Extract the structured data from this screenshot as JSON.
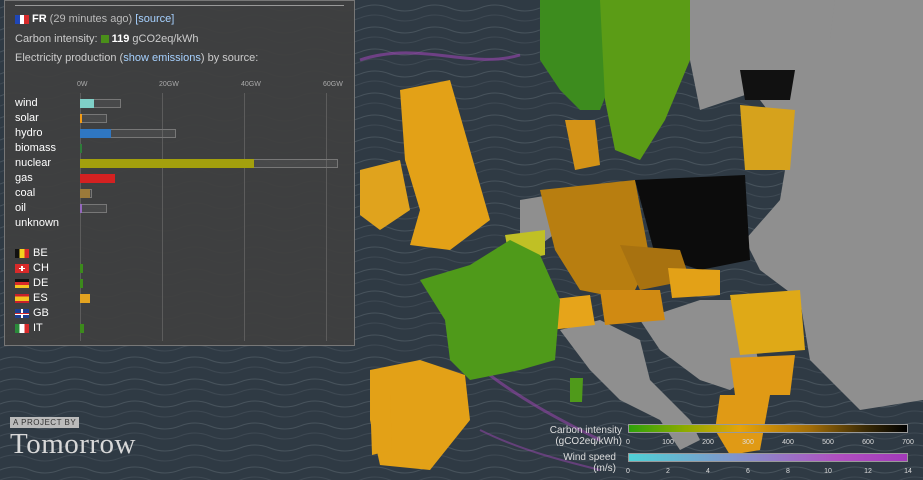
{
  "panel": {
    "country_code": "FR",
    "updated": "(29 minutes ago)",
    "source_link": "[source]",
    "carbon_label": "Carbon intensity:",
    "carbon_value": "119",
    "carbon_unit": "gCO2eq/kWh",
    "production_prefix": "Electricity production (",
    "production_link": "show emissions",
    "production_suffix": ") by source:",
    "axis_ticks": [
      "0W",
      "20GW",
      "40GW",
      "60GW"
    ],
    "sources": [
      {
        "name": "wind",
        "color": "#7fd0c8",
        "value_gw": 3.5,
        "capacity_gw": 10
      },
      {
        "name": "solar",
        "color": "#f39b14",
        "value_gw": 0.5,
        "capacity_gw": 6.5
      },
      {
        "name": "hydro",
        "color": "#2f77c2",
        "value_gw": 7.5,
        "capacity_gw": 23.5
      },
      {
        "name": "biomass",
        "color": "#2e7d3a",
        "value_gw": 0.4,
        "capacity_gw": 0
      },
      {
        "name": "nuclear",
        "color": "#a3a00d",
        "value_gw": 42.5,
        "capacity_gw": 63
      },
      {
        "name": "gas",
        "color": "#d42121",
        "value_gw": 8.5,
        "capacity_gw": 0
      },
      {
        "name": "coal",
        "color": "#9b7a3a",
        "value_gw": 2.5,
        "capacity_gw": 3
      },
      {
        "name": "oil",
        "color": "#9467bd",
        "value_gw": 0.4,
        "capacity_gw": 6.5
      },
      {
        "name": "unknown",
        "color": "#999999",
        "value_gw": 0,
        "capacity_gw": 0
      }
    ],
    "exchanges": [
      {
        "code": "BE",
        "color": "#e3a320",
        "value_gw": 0
      },
      {
        "code": "CH",
        "color": "#3c8a1c",
        "value_gw": 0.5
      },
      {
        "code": "DE",
        "color": "#3c8a1c",
        "value_gw": 0.5
      },
      {
        "code": "ES",
        "color": "#e3a320",
        "value_gw": 2.5
      },
      {
        "code": "GB",
        "color": "#e3a320",
        "value_gw": 0
      },
      {
        "code": "IT",
        "color": "#3c8a1c",
        "value_gw": 1
      }
    ]
  },
  "logo": {
    "tagline": "A PROJECT BY",
    "name": "Tomorrow"
  },
  "legend": {
    "carbon_title_1": "Carbon intensity",
    "carbon_title_2": "(gCO2eq/kWh)",
    "carbon_ticks": [
      "0",
      "100",
      "200",
      "300",
      "400",
      "500",
      "600",
      "700"
    ],
    "wind_title_1": "Wind speed",
    "wind_title_2": "(m/s)",
    "wind_ticks": [
      "0",
      "2",
      "4",
      "6",
      "8",
      "10",
      "12",
      "14"
    ]
  },
  "colors": {
    "panel_bg": "#404040",
    "link": "#a6d1ff",
    "accent_green": "#4a8f1a"
  }
}
